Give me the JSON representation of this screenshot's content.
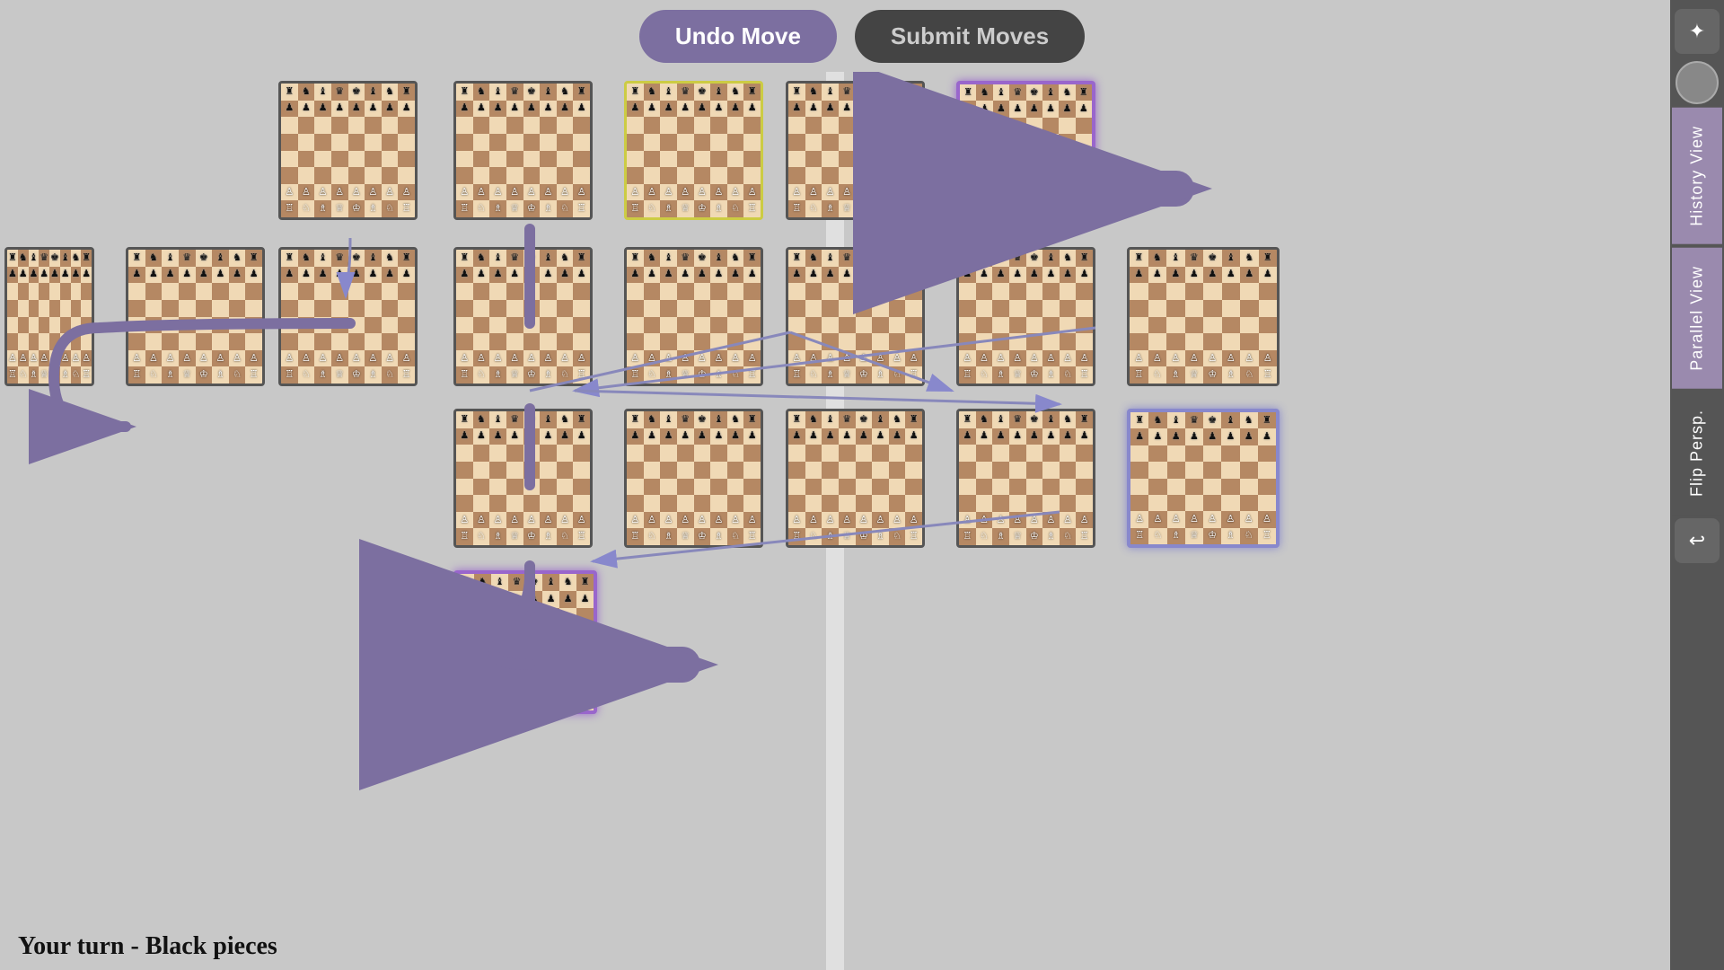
{
  "buttons": {
    "undo_label": "Undo Move",
    "submit_label": "Submit Moves"
  },
  "sidebar": {
    "star_icon": "✦",
    "history_label": "History View",
    "parallel_label": "Parallel View",
    "flip_label": "Flip Persp.",
    "back_icon": "↩"
  },
  "status": {
    "text": "Your turn - Black pieces"
  },
  "colors": {
    "purple": "#7c6fa0",
    "dark": "#444444",
    "accent_purple": "#9966cc",
    "board_light": "#f0d9b5",
    "board_dark": "#b58863"
  }
}
